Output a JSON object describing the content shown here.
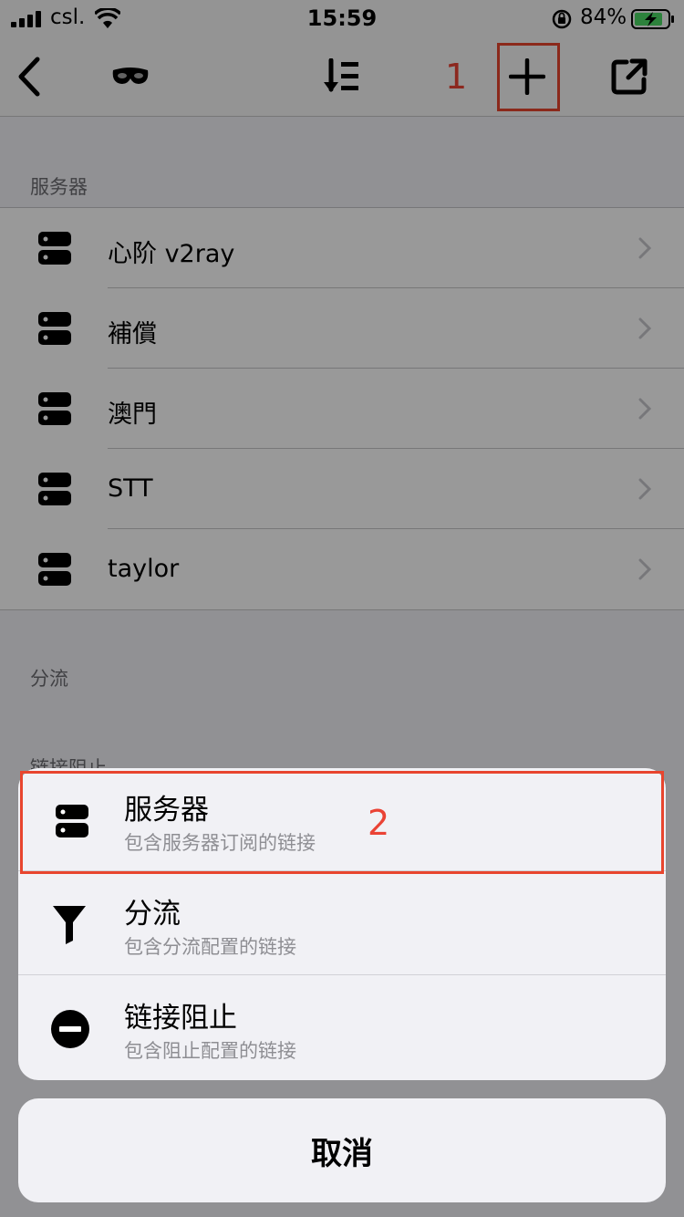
{
  "status_bar": {
    "carrier": "csl.",
    "time": "15:59",
    "battery": "84%"
  },
  "nav": {
    "back_icon": "chevron-left-icon",
    "mask_icon": "mask-icon",
    "sort_icon": "sort-icon",
    "add_icon": "plus-icon",
    "share_icon": "external-link-icon",
    "annotation": "1"
  },
  "sections": {
    "servers_header": "服务器",
    "routing_header": "分流",
    "block_header": "链接阻止"
  },
  "servers": [
    {
      "label": "心阶 v2ray"
    },
    {
      "label": "補償"
    },
    {
      "label": "澳門"
    },
    {
      "label": "STT"
    },
    {
      "label": "taylor"
    }
  ],
  "action_sheet": {
    "annotation": "2",
    "items": [
      {
        "title": "服务器",
        "subtitle": "包含服务器订阅的链接",
        "icon": "server-icon"
      },
      {
        "title": "分流",
        "subtitle": "包含分流配置的链接",
        "icon": "filter-icon"
      },
      {
        "title": "链接阻止",
        "subtitle": "包含阻止配置的链接",
        "icon": "block-icon"
      }
    ],
    "cancel_label": "取消"
  },
  "colors": {
    "annotation_red": "#e8452e",
    "overlay": "rgba(0,0,0,0.4)",
    "sheet_bg": "#f1f1f5"
  }
}
